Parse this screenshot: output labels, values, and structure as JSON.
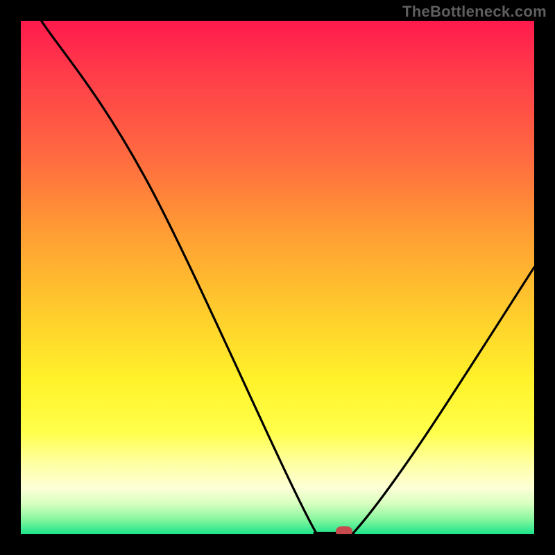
{
  "watermark": "TheBottleneck.com",
  "chart_data": {
    "type": "line",
    "title": "",
    "xlabel": "",
    "ylabel": "",
    "xlim": [
      0,
      100
    ],
    "ylim": [
      0,
      100
    ],
    "grid": false,
    "legend": false,
    "curve_points": [
      {
        "x": 4,
        "y": 100
      },
      {
        "x": 25,
        "y": 68
      },
      {
        "x": 57,
        "y": 1.2
      },
      {
        "x": 62,
        "y": 0
      },
      {
        "x": 65,
        "y": 0.5
      },
      {
        "x": 78,
        "y": 18
      },
      {
        "x": 100,
        "y": 52
      }
    ],
    "flat_minimum_range": {
      "x_start": 57,
      "x_end": 65,
      "y": 0
    },
    "marker": {
      "x": 63,
      "y": 0,
      "color": "#c74a4c"
    },
    "background_gradient_stops": [
      {
        "pos": 0,
        "color": "#ff1a4d"
      },
      {
        "pos": 10,
        "color": "#ff3b4a"
      },
      {
        "pos": 28,
        "color": "#ff6f3f"
      },
      {
        "pos": 42,
        "color": "#ffa033"
      },
      {
        "pos": 58,
        "color": "#ffd02c"
      },
      {
        "pos": 70,
        "color": "#fff22a"
      },
      {
        "pos": 80,
        "color": "#ffff4a"
      },
      {
        "pos": 86,
        "color": "#ffffa0"
      },
      {
        "pos": 91,
        "color": "#fdffd6"
      },
      {
        "pos": 94,
        "color": "#d8ffc0"
      },
      {
        "pos": 97,
        "color": "#8bf7a0"
      },
      {
        "pos": 100,
        "color": "#1be48a"
      }
    ]
  }
}
